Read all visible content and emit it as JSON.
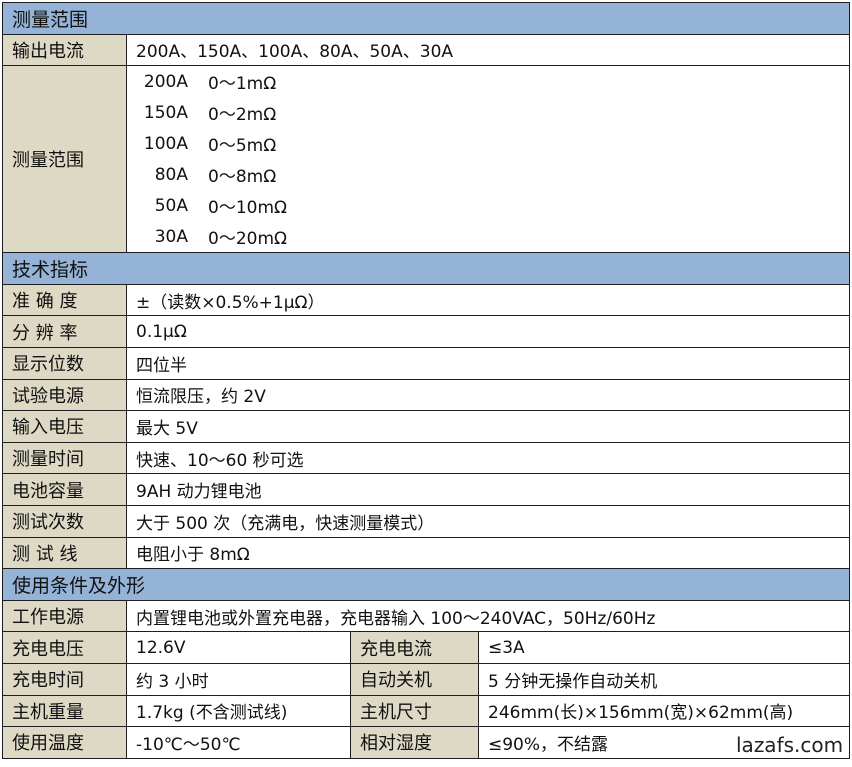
{
  "sections": {
    "measure": "测量范围",
    "tech": "技术指标",
    "conditions": "使用条件及外形"
  },
  "measure": {
    "output_label": "输出电流",
    "output_value": "200A、150A、100A、80A、50A、30A",
    "range_label": "测量范围",
    "ranges": [
      {
        "current": "200A",
        "range": "0～1mΩ"
      },
      {
        "current": "150A",
        "range": "0～2mΩ"
      },
      {
        "current": "100A",
        "range": "0～5mΩ"
      },
      {
        "current": "80A",
        "range": "0～8mΩ"
      },
      {
        "current": "50A",
        "range": "0～10mΩ"
      },
      {
        "current": "30A",
        "range": "0～20mΩ"
      }
    ]
  },
  "tech": [
    {
      "label": "准 确 度",
      "value": "±（读数×0.5%+1μΩ）"
    },
    {
      "label": "分 辨 率",
      "value": "0.1μΩ"
    },
    {
      "label": "显示位数",
      "value": "四位半"
    },
    {
      "label": "试验电源",
      "value": "恒流限压，约 2V"
    },
    {
      "label": "输入电压",
      "value": "最大 5V"
    },
    {
      "label": "测量时间",
      "value": "快速、10～60 秒可选"
    },
    {
      "label": "电池容量",
      "value": "9AH 动力锂电池"
    },
    {
      "label": "测试次数",
      "value": "大于 500 次（充满电，快速测量模式）"
    },
    {
      "label": "测 试 线",
      "value": "电阻小于 8mΩ"
    }
  ],
  "conditions": {
    "power_label": "工作电源",
    "power_value": "内置锂电池或外置充电器，充电器输入 100～240VAC，50Hz/60Hz",
    "rows": [
      {
        "l1": "充电电压",
        "v1": "12.6V",
        "l2": "充电电流",
        "v2": "≤3A"
      },
      {
        "l1": "充电时间",
        "v1": "约 3 小时",
        "l2": "自动关机",
        "v2": "5 分钟无操作自动关机"
      },
      {
        "l1": "主机重量",
        "v1": "1.7kg (不含测试线)",
        "l2": "主机尺寸",
        "v2": "246mm(长)×156mm(宽)×62mm(高)"
      },
      {
        "l1": "使用温度",
        "v1": "-10℃～50℃",
        "l2": "相对湿度",
        "v2": "≤90%，不结露"
      }
    ]
  },
  "watermark": "lazafs.com"
}
